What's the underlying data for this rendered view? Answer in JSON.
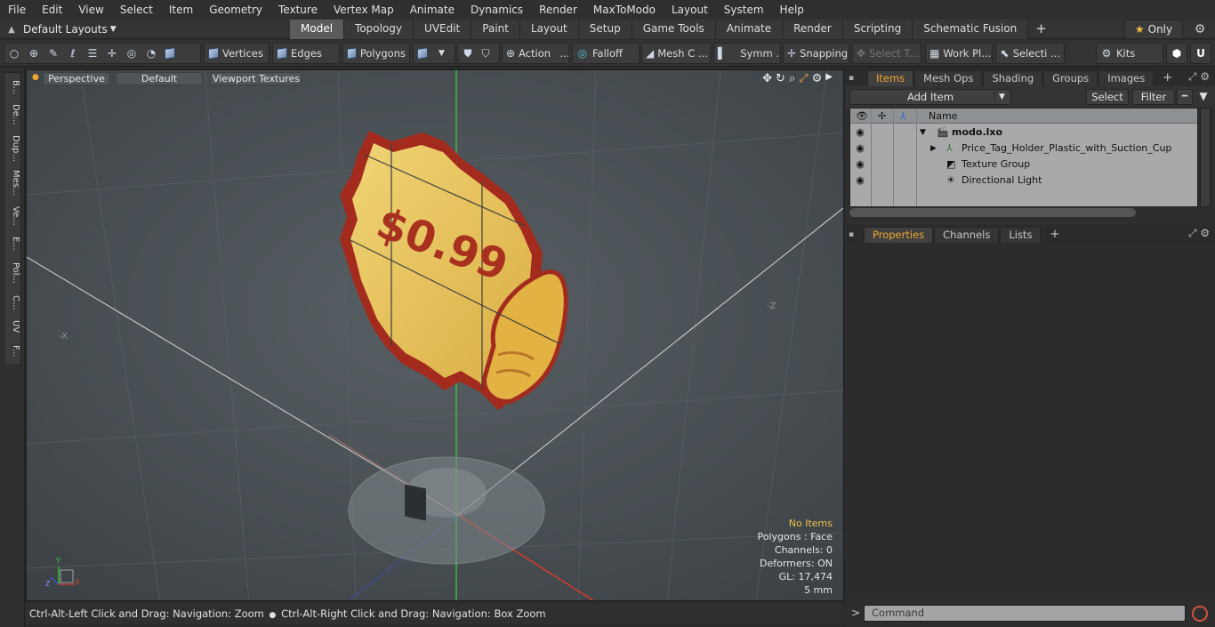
{
  "menu": [
    "File",
    "Edit",
    "View",
    "Select",
    "Item",
    "Geometry",
    "Texture",
    "Vertex Map",
    "Animate",
    "Dynamics",
    "Render",
    "MaxToModo",
    "Layout",
    "System",
    "Help"
  ],
  "layouts": {
    "label": "Default Layouts"
  },
  "tabs": [
    "Model",
    "Topology",
    "UVEdit",
    "Paint",
    "Layout",
    "Setup",
    "Game Tools",
    "Animate",
    "Render",
    "Scripting",
    "Schematic Fusion"
  ],
  "only_label": "Only",
  "toolbar": {
    "vertices": "Vertices",
    "edges": "Edges",
    "polygons": "Polygons",
    "action": "Action",
    "falloff": "Falloff",
    "mesh": "Mesh C ...",
    "symm": "Symm ...",
    "snapping": "Snapping",
    "select_t": "Select T...",
    "workplane": "Work Pl...",
    "selecti": "Selecti ...",
    "kits": "Kits"
  },
  "left_tabs": [
    "B...",
    "De...",
    "Dup...",
    "Mes...",
    "Ve...",
    "E...",
    "Pol...",
    "C...",
    "UV",
    "F..."
  ],
  "viewport": {
    "view": "Perspective",
    "shading": "Default",
    "textures": "Viewport Textures",
    "price_text": "$0.99",
    "axis_neg_x": "-X",
    "axis_neg_z": "-Z",
    "info": {
      "items": "No Items",
      "polygons": "Polygons : Face",
      "channels": "Channels: 0",
      "deformers": "Deformers: ON",
      "gl": "GL: 17,474",
      "scale": "5 mm"
    }
  },
  "status": {
    "text1": "Ctrl-Alt-Left Click and Drag: Navigation: Zoom",
    "text2": "Ctrl-Alt-Right Click and Drag: Navigation: Box Zoom"
  },
  "items_panel": {
    "tabs": [
      "Items",
      "Mesh Ops",
      "Shading",
      "Groups",
      "Images"
    ],
    "add_item": "Add Item",
    "select": "Select",
    "filter": "Filter",
    "name_header": "Name",
    "rows": [
      {
        "name": "modo.lxo"
      },
      {
        "name": "Price_Tag_Holder_Plastic_with_Suction_Cup"
      },
      {
        "name": "Texture Group"
      },
      {
        "name": "Directional Light"
      }
    ]
  },
  "props_panel": {
    "tabs": [
      "Properties",
      "Channels",
      "Lists"
    ]
  },
  "command": {
    "placeholder": "Command",
    "prompt": ">"
  },
  "colors": {
    "accent": "#f2a531",
    "viewport_bg": "#4a5054",
    "tag_yellow": "#e9c65a",
    "tag_red": "#9d241b"
  }
}
